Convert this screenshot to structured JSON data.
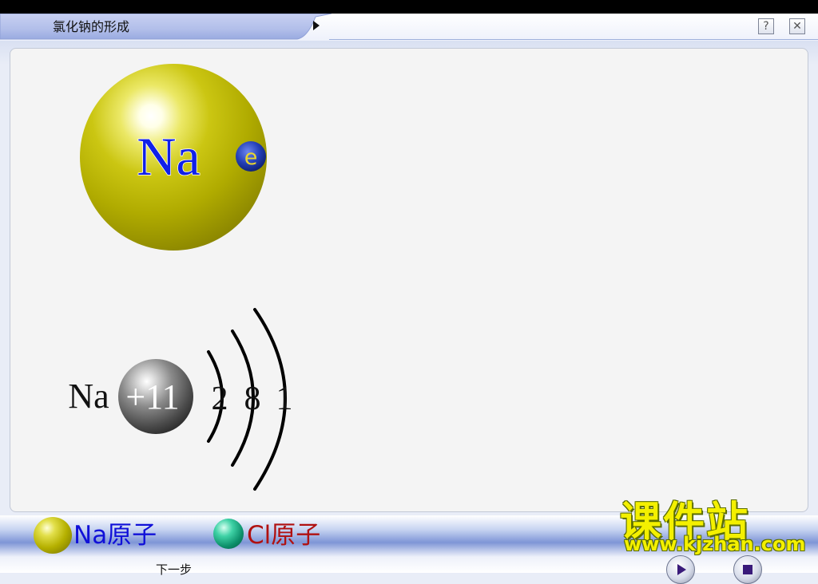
{
  "window": {
    "title": "氯化钠的形成",
    "help_label": "?",
    "close_label": "✕"
  },
  "stage": {
    "atom_symbol": "Na",
    "electron_label": "e",
    "diagram_element": "Na",
    "nucleus_charge": "+11",
    "shells": [
      "2",
      "8",
      "1"
    ]
  },
  "legend": {
    "na_label": "Na原子",
    "cl_label": "Cl原子"
  },
  "logo": {
    "cn": "课件站",
    "url": "www.kjzhan.com"
  },
  "controls": {
    "next_step": "下一步"
  },
  "colors": {
    "atom_yellow": "#b5b000",
    "na_text": "#1010d8",
    "cl_text": "#b01010",
    "logo_yellow": "#f4f000"
  }
}
